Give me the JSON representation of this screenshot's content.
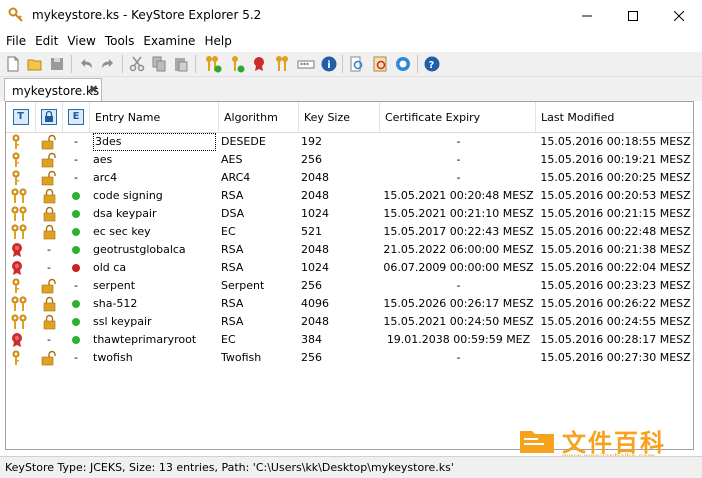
{
  "window": {
    "title": "mykeystore.ks - KeyStore Explorer 5.2",
    "minimize_icon": "minimize-icon",
    "maximize_icon": "maximize-icon",
    "close_icon": "close-icon"
  },
  "menu": [
    "File",
    "Edit",
    "View",
    "Tools",
    "Examine",
    "Help"
  ],
  "toolbar": {
    "buttons": [
      "new-icon",
      "open-icon",
      "save-icon",
      "undo-icon",
      "redo-icon",
      "cut-icon",
      "copy-icon",
      "paste-icon",
      "generate-keypair-icon",
      "generate-secret-key-icon",
      "import-trusted-cert-icon",
      "import-keypair-icon",
      "set-password-icon",
      "properties-icon",
      "examine-file-icon",
      "examine-clipboard-icon",
      "examine-ssl-icon",
      "help-icon"
    ]
  },
  "tab": {
    "label": "mykeystore.ks",
    "close": "✖"
  },
  "table": {
    "icon_columns": [
      "T",
      "lock-icon",
      "E"
    ],
    "headers": [
      "Entry Name",
      "Algorithm",
      "Key Size",
      "Certificate Expiry",
      "Last Modified"
    ],
    "rows": [
      {
        "type": "secret-key",
        "lock": "unlocked",
        "status": "-",
        "name": "3des",
        "algorithm": "DESEDE",
        "size": "192",
        "expiry": "-",
        "modified": "15.05.2016 00:18:55 MESZ"
      },
      {
        "type": "secret-key",
        "lock": "unlocked",
        "status": "-",
        "name": "aes",
        "algorithm": "AES",
        "size": "256",
        "expiry": "-",
        "modified": "15.05.2016 00:19:21 MESZ"
      },
      {
        "type": "secret-key",
        "lock": "unlocked",
        "status": "-",
        "name": "arc4",
        "algorithm": "ARC4",
        "size": "2048",
        "expiry": "-",
        "modified": "15.05.2016 00:20:25 MESZ"
      },
      {
        "type": "key-pair",
        "lock": "locked",
        "status": "valid",
        "name": "code signing",
        "algorithm": "RSA",
        "size": "2048",
        "expiry": "15.05.2021 00:20:48 MESZ",
        "modified": "15.05.2016 00:20:53 MESZ"
      },
      {
        "type": "key-pair",
        "lock": "locked",
        "status": "valid",
        "name": "dsa keypair",
        "algorithm": "DSA",
        "size": "1024",
        "expiry": "15.05.2021 00:21:10 MESZ",
        "modified": "15.05.2016 00:21:15 MESZ"
      },
      {
        "type": "key-pair",
        "lock": "locked",
        "status": "valid",
        "name": "ec sec key",
        "algorithm": "EC",
        "size": "521",
        "expiry": "15.05.2017 00:22:43 MESZ",
        "modified": "15.05.2016 00:22:48 MESZ"
      },
      {
        "type": "trusted-cert",
        "lock": "-",
        "status": "valid",
        "name": "geotrustglobalca",
        "algorithm": "RSA",
        "size": "2048",
        "expiry": "21.05.2022 06:00:00 MESZ",
        "modified": "15.05.2016 00:21:38 MESZ"
      },
      {
        "type": "trusted-cert",
        "lock": "-",
        "status": "expired",
        "name": "old ca",
        "algorithm": "RSA",
        "size": "1024",
        "expiry": "06.07.2009 00:00:00 MESZ",
        "modified": "15.05.2016 00:22:04 MESZ"
      },
      {
        "type": "secret-key",
        "lock": "unlocked",
        "status": "-",
        "name": "serpent",
        "algorithm": "Serpent",
        "size": "256",
        "expiry": "-",
        "modified": "15.05.2016 00:23:23 MESZ"
      },
      {
        "type": "key-pair",
        "lock": "locked",
        "status": "valid",
        "name": "sha-512",
        "algorithm": "RSA",
        "size": "4096",
        "expiry": "15.05.2026 00:26:17 MESZ",
        "modified": "15.05.2016 00:26:22 MESZ"
      },
      {
        "type": "key-pair",
        "lock": "locked",
        "status": "valid",
        "name": "ssl keypair",
        "algorithm": "RSA",
        "size": "2048",
        "expiry": "15.05.2021 00:24:50 MESZ",
        "modified": "15.05.2016 00:24:55 MESZ"
      },
      {
        "type": "trusted-cert",
        "lock": "-",
        "status": "valid",
        "name": "thawteprimaryroot",
        "algorithm": "EC",
        "size": "384",
        "expiry": "19.01.2038 00:59:59 MEZ",
        "modified": "15.05.2016 00:28:17 MESZ"
      },
      {
        "type": "secret-key",
        "lock": "unlocked",
        "status": "-",
        "name": "twofish",
        "algorithm": "Twofish",
        "size": "256",
        "expiry": "-",
        "modified": "15.05.2016 00:27:30 MESZ"
      }
    ]
  },
  "status_bar": "KeyStore Type: JCEKS, Size: 13 entries, Path: 'C:\\Users\\kk\\Desktop\\mykeystore.ks'",
  "watermark": {
    "text": "文件百科",
    "url": "www.wenjianbaike.com"
  },
  "colors": {
    "valid": "#2fb02f",
    "expired": "#cc2020",
    "key_gold": "#e0a020",
    "cert_red": "#cc2b2b",
    "toolbar_bg": "#f0f0f0",
    "watermark": "#f7a21c"
  }
}
